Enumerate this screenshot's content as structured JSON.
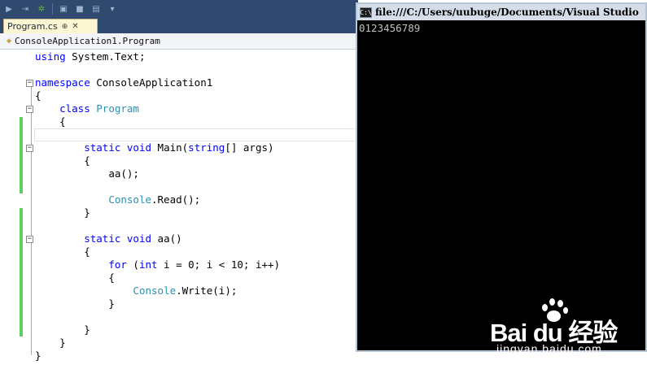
{
  "ide": {
    "tab": {
      "label": "Program.cs",
      "pin_glyph": "⊕",
      "close_glyph": "✕"
    },
    "navbar": {
      "class_path": "ConsoleApplication1.Program",
      "icon": "class-icon"
    },
    "toolbar_icons": [
      "step-icon",
      "step-over-icon",
      "build-icon",
      "save-icon",
      "stop-icon",
      "window-icon",
      "dropdown-icon"
    ],
    "code": {
      "l1": {
        "kw": "using",
        "rest": " System.Text;"
      },
      "l3": {
        "kw": "namespace",
        "rest": " ConsoleApplication1"
      },
      "l4": "{",
      "l5": {
        "kw": "class",
        "ty": "Program"
      },
      "l6": "{",
      "l8": {
        "kw1": "static",
        "kw2": "void",
        "name": " Main(",
        "kw3": "string",
        "rest": "[] args)"
      },
      "l9": "{",
      "l10": "aa();",
      "l12": {
        "ty": "Console",
        "rest": ".Read();"
      },
      "l13": "}",
      "l15": {
        "kw1": "static",
        "kw2": "void",
        "rest": " aa()"
      },
      "l16": "{",
      "l17": {
        "kw": "for",
        "p1": " (",
        "kw2": "int",
        "rest": " i = 0; i < 10; i++)"
      },
      "l18": "{",
      "l19": {
        "ty": "Console",
        "rest": ".Write(i);"
      },
      "l20": "}",
      "l22": "}",
      "l23": "}",
      "l24": "}"
    }
  },
  "console": {
    "title": "file:///C:/Users/uubuge/Documents/Visual Studio",
    "output": "0123456789"
  },
  "watermark": {
    "logo": "Bai du 经验",
    "sub": "jingyan.baidu.com"
  },
  "colors": {
    "keyword": "#0000ff",
    "type": "#2b91af",
    "changed_margin": "#5fcf5f",
    "console_bg": "#000000",
    "console_text": "#c0c0c0"
  }
}
